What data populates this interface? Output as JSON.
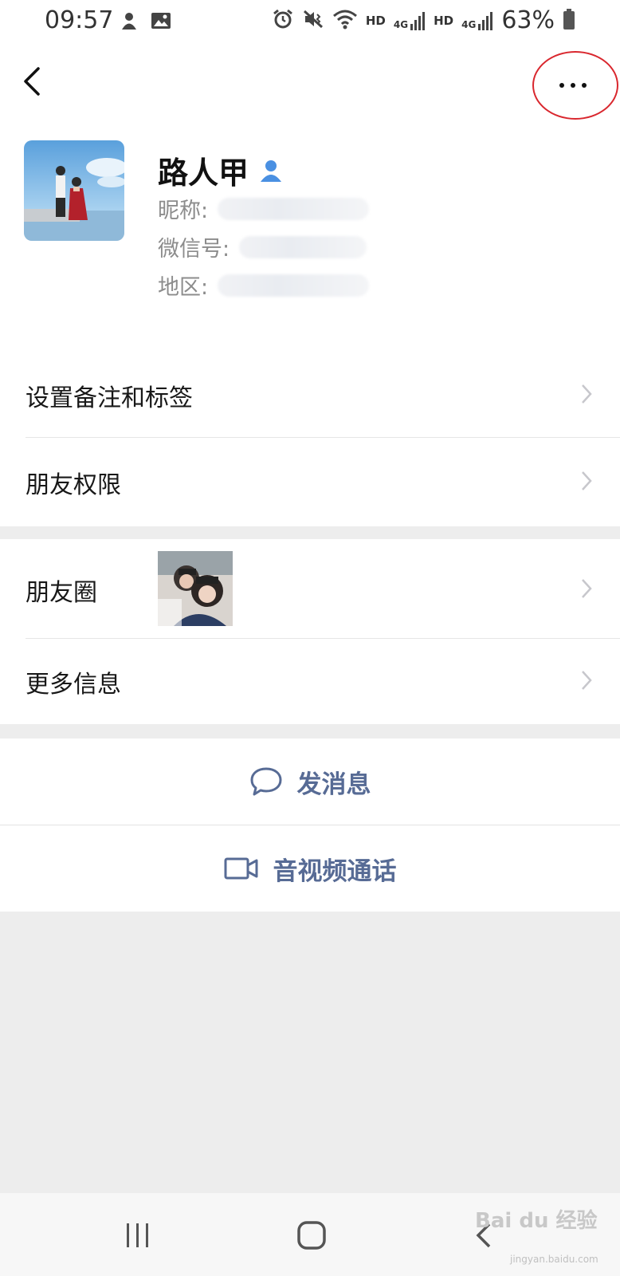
{
  "status_bar": {
    "time": "09:57",
    "hd1": "HD",
    "net1": "4G",
    "hd2": "HD",
    "net2": "4G",
    "battery": "63%"
  },
  "header": {
    "back_icon": "chevron-left-icon",
    "more_icon": "ellipsis-icon"
  },
  "profile": {
    "name": "路人甲",
    "nickname_label": "昵称:",
    "wechat_id_label": "微信号:",
    "region_label": "地区:"
  },
  "menu": {
    "remark_tags": "设置备注和标签",
    "friend_permissions": "朋友权限",
    "moments": "朋友圈",
    "more_info": "更多信息"
  },
  "actions": {
    "send_message": "发消息",
    "video_call": "音视频通话"
  },
  "colors": {
    "link_blue": "#576b95",
    "highlight_red": "#d9272e",
    "background": "#ededed"
  },
  "watermark": {
    "text": "Bai du 经验",
    "sub": "jingyan.baidu.com"
  }
}
